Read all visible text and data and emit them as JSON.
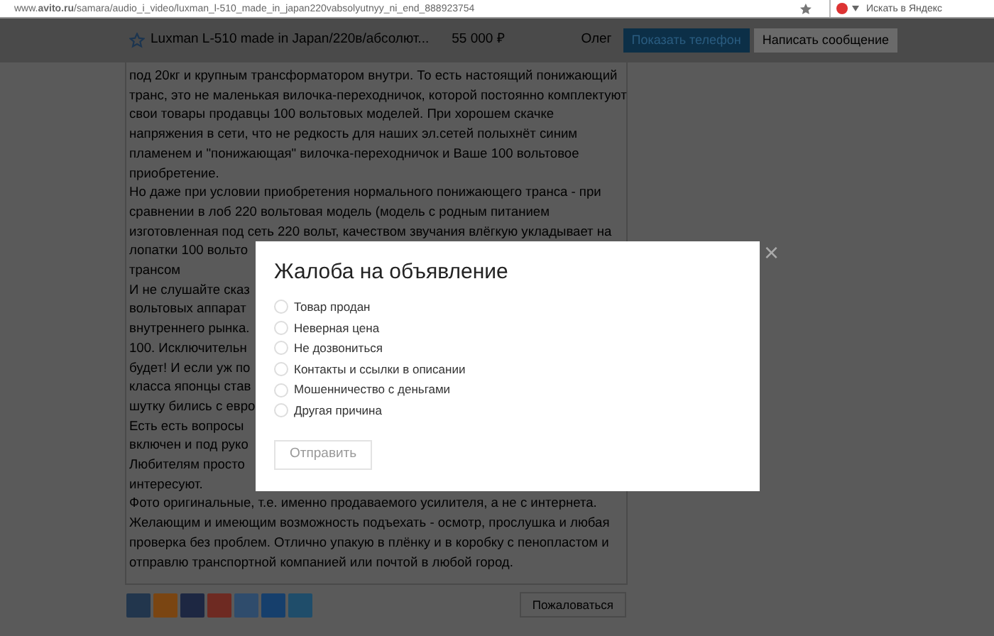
{
  "browser": {
    "url": "www.**avito.ru**/samara/audio_i_video/luxman_l-510_made_in_japan220vabsolyutnyy_ni_end_888923754",
    "search_placeholder": "Искать в Яндекс"
  },
  "header": {
    "title": "Luxman L-510 made in Japan/220в/абсолют...",
    "price": "55 000 ₽",
    "seller": "Олег",
    "show_phone": "Показать телефон",
    "write_message": "Написать сообщение"
  },
  "description": [
    "под 20кг и крупным трансформатором внутри. То есть настоящий понижающий",
    "транс, это не маленькая вилочка-переходничок, которой постоянно комплектуют",
    "свои товары продавцы 100 вольтовых моделей. При хорошем скачке",
    "напряжения в сети, что не редкость для наших эл.сетей полыхнёт синим",
    "пламенем и \"понижающая\" вилочка-переходничок и Ваше 100 вольтовое",
    "приобретение.",
    "Но даже при условии приобретения нормального понижающего транса - при",
    "сравнении в лоб 220 вольтовая модель (модель с родным питанием",
    "изготовленная под сеть 220 вольт, качеством звучания влёгкую укладывает на",
    "лопатки 100 вольто",
    "трансом",
    "И не слушайте сказ",
    "вольтовых аппарат",
    "внутреннего рынка.",
    "100. Исключительн",
    "будет! И если уж по",
    "класса японцы став",
    "шутку бились с евро",
    "Есть есть вопросы",
    "включен и под руко",
    "Любителям просто",
    "интересуют.",
    "Фото оригинальные, т.е. именно продаваемого усилителя, а не с интернета.",
    "Желающим и имеющим возможность подъехать - осмотр, прослушка и любая",
    "проверка без проблем. Отлично упакую в плёнку и в коробку с пенопластом и",
    "отправлю транспортной компанией или почтой в любой город."
  ],
  "share_buttons": [
    {
      "color": "#22364d"
    },
    {
      "color": "#7a4512"
    },
    {
      "color": "#1d2742"
    },
    {
      "color": "#6e2a22"
    },
    {
      "color": "#2f4c6c"
    },
    {
      "color": "#163f6c"
    },
    {
      "color": "#1f4d6a"
    }
  ],
  "report_button": "Пожаловаться",
  "modal": {
    "title": "Жалоба на объявление",
    "options": [
      {
        "label": "Товар продан",
        "selected": false
      },
      {
        "label": "Неверная цена",
        "selected": false
      },
      {
        "label": "Не дозвониться",
        "selected": false
      },
      {
        "label": "Контакты и ссылки в описании",
        "selected": false
      },
      {
        "label": "Мошенничество с деньгами",
        "selected": false
      },
      {
        "label": "Другая причина",
        "selected": false
      }
    ],
    "submit": {
      "label": "Отправить",
      "disabled": true
    },
    "close": "×"
  }
}
